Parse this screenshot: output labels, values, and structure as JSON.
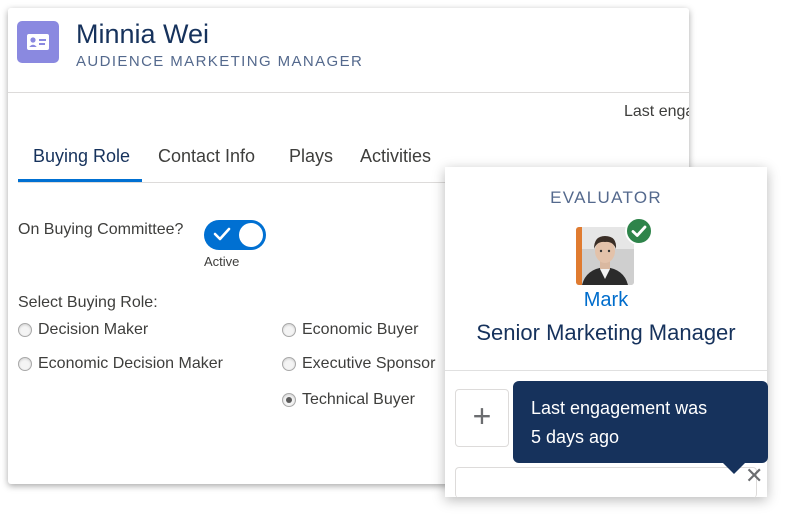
{
  "contact": {
    "name": "Minnia Wei",
    "title": "AUDIENCE MARKETING MANAGER",
    "icon": "contact-card-icon"
  },
  "last_engagement_label_clipped": "Last enga",
  "tabs": [
    {
      "label": "Buying Role",
      "active": true
    },
    {
      "label": "Contact Info",
      "active": false
    },
    {
      "label": "Plays",
      "active": false
    },
    {
      "label": "Activities",
      "active": false
    }
  ],
  "committee": {
    "label": "On Buying Committee?",
    "toggle_on": true,
    "status": "Active"
  },
  "buying_role": {
    "label": "Select Buying Role:",
    "selected": "Technical Buyer",
    "options": [
      "Decision Maker",
      "Economic Decision Maker",
      "Economic Buyer",
      "Executive Sponsor",
      "Technical Buyer"
    ]
  },
  "evaluator": {
    "role": "EVALUATOR",
    "name": "Mark",
    "title": "Senior Marketing Manager",
    "verified": true
  },
  "tooltip": {
    "line1": "Last engagement was",
    "line2": "5 days ago"
  },
  "colors": {
    "brand_blue": "#0070d2",
    "link_blue": "#006dcc",
    "navy": "#16325c",
    "header_icon_purple": "#8a89e0",
    "verified_green": "#2e844a",
    "avatar_accent": "#e07b30"
  }
}
